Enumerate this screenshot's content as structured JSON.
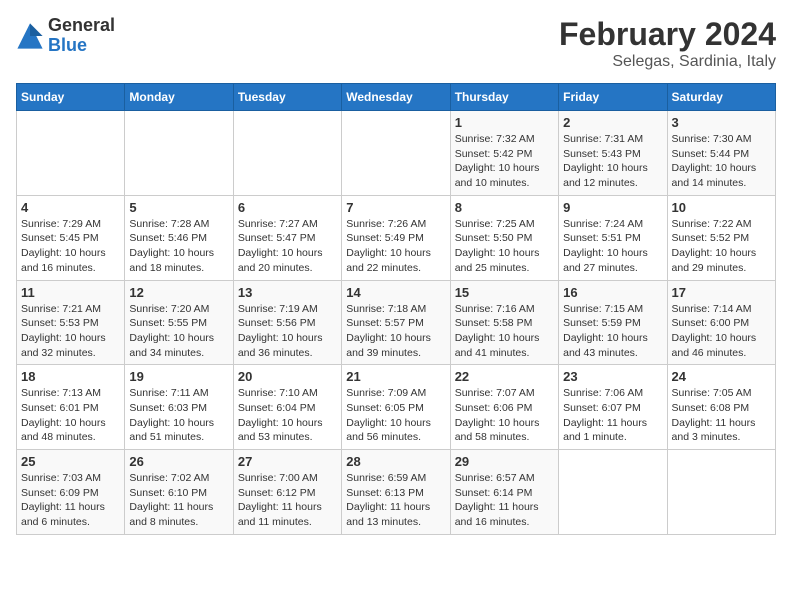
{
  "header": {
    "logo_general": "General",
    "logo_blue": "Blue",
    "month_year": "February 2024",
    "location": "Selegas, Sardinia, Italy"
  },
  "days_of_week": [
    "Sunday",
    "Monday",
    "Tuesday",
    "Wednesday",
    "Thursday",
    "Friday",
    "Saturday"
  ],
  "weeks": [
    {
      "days": [
        {
          "number": "",
          "info": ""
        },
        {
          "number": "",
          "info": ""
        },
        {
          "number": "",
          "info": ""
        },
        {
          "number": "",
          "info": ""
        },
        {
          "number": "1",
          "info": "Sunrise: 7:32 AM\nSunset: 5:42 PM\nDaylight: 10 hours and 10 minutes."
        },
        {
          "number": "2",
          "info": "Sunrise: 7:31 AM\nSunset: 5:43 PM\nDaylight: 10 hours and 12 minutes."
        },
        {
          "number": "3",
          "info": "Sunrise: 7:30 AM\nSunset: 5:44 PM\nDaylight: 10 hours and 14 minutes."
        }
      ]
    },
    {
      "days": [
        {
          "number": "4",
          "info": "Sunrise: 7:29 AM\nSunset: 5:45 PM\nDaylight: 10 hours and 16 minutes."
        },
        {
          "number": "5",
          "info": "Sunrise: 7:28 AM\nSunset: 5:46 PM\nDaylight: 10 hours and 18 minutes."
        },
        {
          "number": "6",
          "info": "Sunrise: 7:27 AM\nSunset: 5:47 PM\nDaylight: 10 hours and 20 minutes."
        },
        {
          "number": "7",
          "info": "Sunrise: 7:26 AM\nSunset: 5:49 PM\nDaylight: 10 hours and 22 minutes."
        },
        {
          "number": "8",
          "info": "Sunrise: 7:25 AM\nSunset: 5:50 PM\nDaylight: 10 hours and 25 minutes."
        },
        {
          "number": "9",
          "info": "Sunrise: 7:24 AM\nSunset: 5:51 PM\nDaylight: 10 hours and 27 minutes."
        },
        {
          "number": "10",
          "info": "Sunrise: 7:22 AM\nSunset: 5:52 PM\nDaylight: 10 hours and 29 minutes."
        }
      ]
    },
    {
      "days": [
        {
          "number": "11",
          "info": "Sunrise: 7:21 AM\nSunset: 5:53 PM\nDaylight: 10 hours and 32 minutes."
        },
        {
          "number": "12",
          "info": "Sunrise: 7:20 AM\nSunset: 5:55 PM\nDaylight: 10 hours and 34 minutes."
        },
        {
          "number": "13",
          "info": "Sunrise: 7:19 AM\nSunset: 5:56 PM\nDaylight: 10 hours and 36 minutes."
        },
        {
          "number": "14",
          "info": "Sunrise: 7:18 AM\nSunset: 5:57 PM\nDaylight: 10 hours and 39 minutes."
        },
        {
          "number": "15",
          "info": "Sunrise: 7:16 AM\nSunset: 5:58 PM\nDaylight: 10 hours and 41 minutes."
        },
        {
          "number": "16",
          "info": "Sunrise: 7:15 AM\nSunset: 5:59 PM\nDaylight: 10 hours and 43 minutes."
        },
        {
          "number": "17",
          "info": "Sunrise: 7:14 AM\nSunset: 6:00 PM\nDaylight: 10 hours and 46 minutes."
        }
      ]
    },
    {
      "days": [
        {
          "number": "18",
          "info": "Sunrise: 7:13 AM\nSunset: 6:01 PM\nDaylight: 10 hours and 48 minutes."
        },
        {
          "number": "19",
          "info": "Sunrise: 7:11 AM\nSunset: 6:03 PM\nDaylight: 10 hours and 51 minutes."
        },
        {
          "number": "20",
          "info": "Sunrise: 7:10 AM\nSunset: 6:04 PM\nDaylight: 10 hours and 53 minutes."
        },
        {
          "number": "21",
          "info": "Sunrise: 7:09 AM\nSunset: 6:05 PM\nDaylight: 10 hours and 56 minutes."
        },
        {
          "number": "22",
          "info": "Sunrise: 7:07 AM\nSunset: 6:06 PM\nDaylight: 10 hours and 58 minutes."
        },
        {
          "number": "23",
          "info": "Sunrise: 7:06 AM\nSunset: 6:07 PM\nDaylight: 11 hours and 1 minute."
        },
        {
          "number": "24",
          "info": "Sunrise: 7:05 AM\nSunset: 6:08 PM\nDaylight: 11 hours and 3 minutes."
        }
      ]
    },
    {
      "days": [
        {
          "number": "25",
          "info": "Sunrise: 7:03 AM\nSunset: 6:09 PM\nDaylight: 11 hours and 6 minutes."
        },
        {
          "number": "26",
          "info": "Sunrise: 7:02 AM\nSunset: 6:10 PM\nDaylight: 11 hours and 8 minutes."
        },
        {
          "number": "27",
          "info": "Sunrise: 7:00 AM\nSunset: 6:12 PM\nDaylight: 11 hours and 11 minutes."
        },
        {
          "number": "28",
          "info": "Sunrise: 6:59 AM\nSunset: 6:13 PM\nDaylight: 11 hours and 13 minutes."
        },
        {
          "number": "29",
          "info": "Sunrise: 6:57 AM\nSunset: 6:14 PM\nDaylight: 11 hours and 16 minutes."
        },
        {
          "number": "",
          "info": ""
        },
        {
          "number": "",
          "info": ""
        }
      ]
    }
  ]
}
